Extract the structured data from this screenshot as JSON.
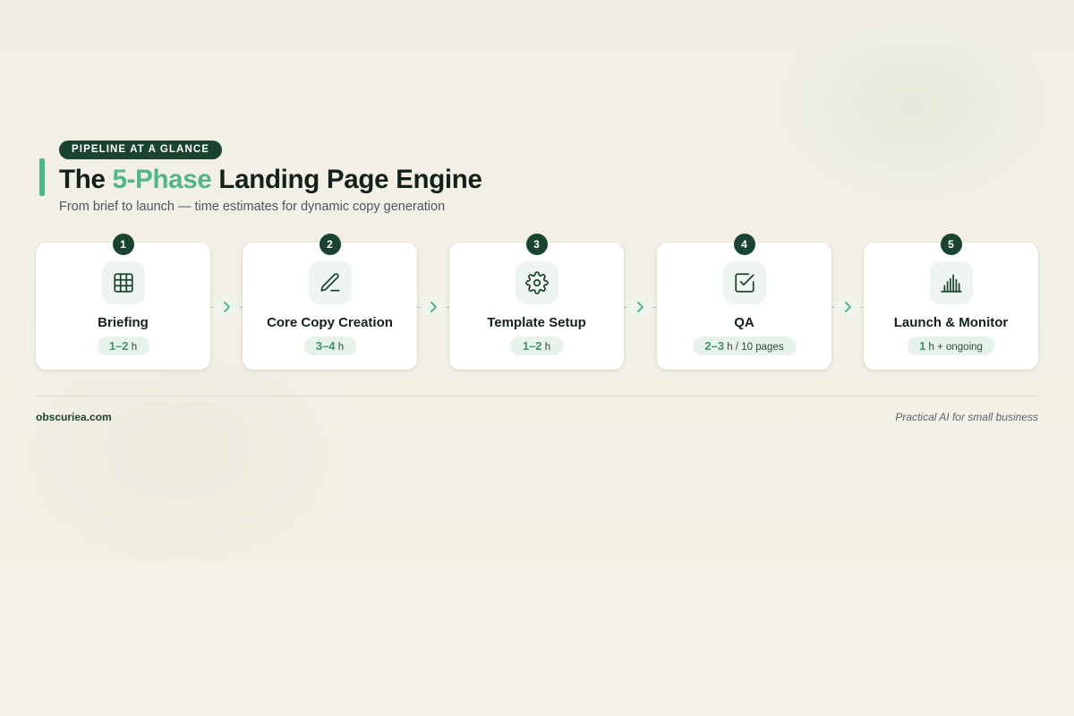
{
  "header": {
    "badge": "PIPELINE AT A GLANCE",
    "title_before": "The ",
    "title_highlight": "5-Phase",
    "title_after": " Landing Page Engine",
    "subtitle": "From brief to launch — time estimates for dynamic copy generation"
  },
  "phases": [
    {
      "number": "1",
      "label": "Briefing",
      "time_value": "1–2",
      "time_unit": " h",
      "icon": "grid-icon"
    },
    {
      "number": "2",
      "label": "Core Copy Creation",
      "time_value": "3–4",
      "time_unit": " h",
      "icon": "pencil-icon"
    },
    {
      "number": "3",
      "label": "Template Setup",
      "time_value": "1–2",
      "time_unit": " h",
      "icon": "gear-icon"
    },
    {
      "number": "4",
      "label": "QA",
      "time_value": "2–3",
      "time_unit": " h / 10 pages",
      "icon": "checkbox-icon"
    },
    {
      "number": "5",
      "label": "Launch & Monitor",
      "time_value": "1",
      "time_unit": " h + ongoing",
      "icon": "bar-chart-icon"
    }
  ],
  "footer": {
    "site": "obscuriea.com",
    "tagline": "Practical AI for small business"
  },
  "colors": {
    "accent": "#52b788",
    "dark": "#1b4332",
    "background": "#f5f1e7"
  }
}
